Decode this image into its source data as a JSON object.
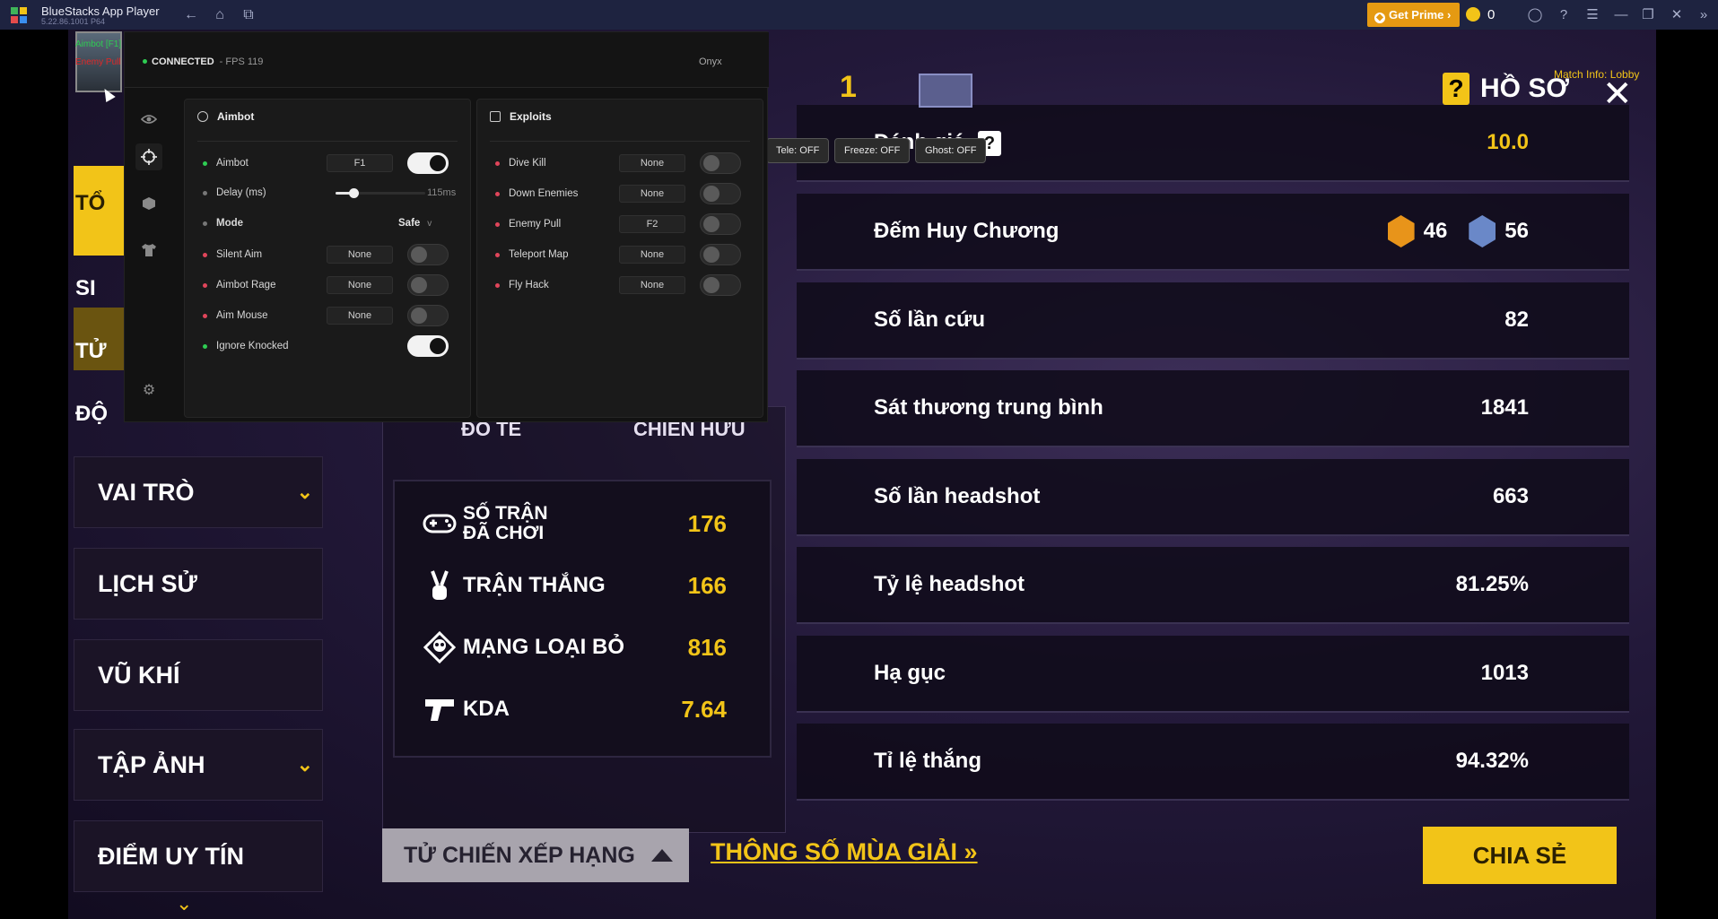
{
  "titlebar": {
    "app_name": "BlueStacks App Player",
    "version": "5.22.86.1001 P64",
    "get_prime": "Get Prime",
    "coins": "0"
  },
  "game": {
    "left_nav": {
      "partials": [
        "TỔ",
        "SI",
        "TỬ",
        "ĐỘ"
      ],
      "items": [
        {
          "label": "VAI TRÒ",
          "has_chevron": true
        },
        {
          "label": "LỊCH SỬ",
          "has_chevron": false
        },
        {
          "label": "VŨ KHÍ",
          "has_chevron": false
        },
        {
          "label": "TẬP ẢNH",
          "has_chevron": true
        },
        {
          "label": "ĐIỂM UY TÍN",
          "has_chevron": false
        }
      ]
    },
    "sub_headers": [
      "ĐỒ TỂ",
      "CHIẾN HỮU"
    ],
    "stats": [
      {
        "label": "SỐ TRẬN ĐÃ CHƠI",
        "value": "176",
        "icon": "gamepad-icon"
      },
      {
        "label": "TRẬN THẮNG",
        "value": "166",
        "icon": "victory-hand-icon"
      },
      {
        "label": "MẠNG LOẠI BỎ",
        "value": "816",
        "icon": "skull-icon"
      },
      {
        "label": "KDA",
        "value": "7.64",
        "icon": "pistol-icon"
      }
    ],
    "details": [
      {
        "label": "Đánh giá",
        "value": "10.0",
        "gold": true
      },
      {
        "label": "Đếm Huy Chương",
        "value": "",
        "medals": [
          "46",
          "56"
        ]
      },
      {
        "label": "Số lần cứu",
        "value": "82"
      },
      {
        "label": "Sát thương trung bình",
        "value": "1841"
      },
      {
        "label": "Số lần headshot",
        "value": "663"
      },
      {
        "label": "Tỷ lệ headshot",
        "value": "81.25%"
      },
      {
        "label": "Hạ gục",
        "value": "1013"
      },
      {
        "label": "Tỉ lệ thắng",
        "value": "94.32%"
      }
    ],
    "ho_so": "HỒ SƠ",
    "match_info": "Match Info: Lobby",
    "rank_level": "1",
    "rank_button": "TỬ CHIẾN XẾP HẠNG",
    "season_link": "THÔNG SỐ MÙA GIẢI",
    "share_button": "CHIA SẺ",
    "quick_buttons": [
      "Tele: OFF",
      "Freeze: OFF",
      "Ghost: OFF"
    ]
  },
  "overlay": {
    "status": "CONNECTED",
    "fps": "- FPS 119",
    "brand": "Onyx",
    "aimbot_panel": {
      "title": "Aimbot",
      "rows": [
        {
          "label": "Aimbot",
          "key": "F1",
          "toggle": true,
          "bullet": "green"
        },
        {
          "label": "Delay (ms)",
          "slider_value": "115ms",
          "bullet": "grey"
        },
        {
          "label": "Mode",
          "mode": "Safe",
          "bullet": "grey"
        },
        {
          "label": "Silent Aim",
          "key": "None",
          "toggle": false,
          "bullet": "red"
        },
        {
          "label": "Aimbot Rage",
          "key": "None",
          "toggle": false,
          "bullet": "red"
        },
        {
          "label": "Aim Mouse",
          "key": "None",
          "toggle": false,
          "bullet": "red"
        },
        {
          "label": "Ignore Knocked",
          "toggle": true,
          "bullet": "green"
        }
      ]
    },
    "exploits_panel": {
      "title": "Exploits",
      "rows": [
        {
          "label": "Dive Kill",
          "key": "None",
          "toggle": false
        },
        {
          "label": "Down Enemies",
          "key": "None",
          "toggle": false
        },
        {
          "label": "Enemy Pull",
          "key": "F2",
          "toggle": false
        },
        {
          "label": "Teleport Map",
          "key": "None",
          "toggle": false
        },
        {
          "label": "Fly Hack",
          "key": "None",
          "toggle": false
        }
      ]
    },
    "mode_caret": "v",
    "delay_fraction": 0.2
  },
  "hud": {
    "aimbot_on": "Aimbot [F1] : ON",
    "enemy_pull": "Enemy Pull [F2] : OFF"
  },
  "colors": {
    "gold": "#f2c418",
    "green": "#2ecc52",
    "red": "#e0455a"
  }
}
